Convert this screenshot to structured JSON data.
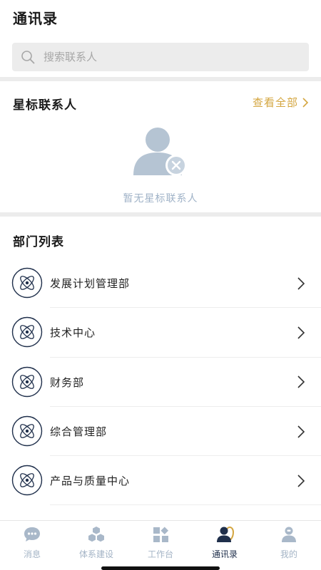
{
  "header": {
    "title": "通讯录"
  },
  "search": {
    "placeholder": "搜索联系人"
  },
  "starred": {
    "title": "星标联系人",
    "view_all": "查看全部",
    "empty_text": "暂无星标联系人"
  },
  "departments": {
    "title": "部门列表",
    "items": [
      {
        "label": "发展计划管理部"
      },
      {
        "label": "技术中心"
      },
      {
        "label": "财务部"
      },
      {
        "label": "综合管理部"
      },
      {
        "label": "产品与质量中心"
      }
    ]
  },
  "tabbar": {
    "items": [
      {
        "label": "消息",
        "icon": "chat-bubble-icon"
      },
      {
        "label": "体系建设",
        "icon": "cubes-icon"
      },
      {
        "label": "工作台",
        "icon": "grid-icon"
      },
      {
        "label": "通讯录",
        "icon": "contacts-icon",
        "active": true
      },
      {
        "label": "我的",
        "icon": "profile-icon"
      }
    ]
  },
  "colors": {
    "accent_gold": "#d4a640",
    "muted_blue": "#9fb2c7",
    "tab_inactive": "#a4b4c6",
    "tab_active": "#1f2f4b",
    "icon_navy": "#1f2f4b"
  }
}
